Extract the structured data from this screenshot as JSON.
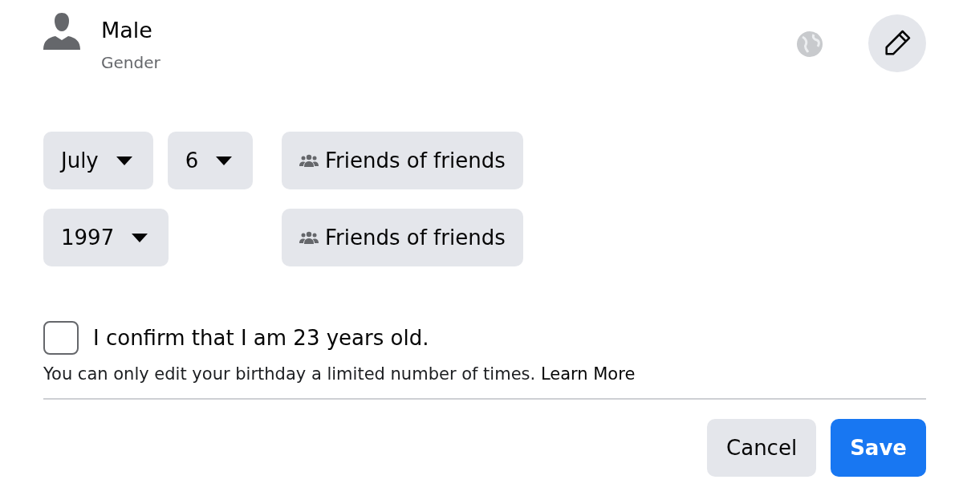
{
  "gender": {
    "value": "Male",
    "label": "Gender"
  },
  "birthday_rows": [
    {
      "selects": [
        {
          "value": "July"
        },
        {
          "value": "6"
        }
      ],
      "audience": "Friends of friends"
    },
    {
      "selects": [
        {
          "value": "1997"
        }
      ],
      "audience": "Friends of friends"
    }
  ],
  "confirm": {
    "label": "I confirm that I am 23 years old.",
    "checked": false
  },
  "note": {
    "text": "You can only edit your birthday a limited number of times.",
    "link": "Learn More"
  },
  "buttons": [
    {
      "label": "Cancel",
      "kind": "secondary"
    },
    {
      "label": "Save",
      "kind": "primary"
    }
  ]
}
